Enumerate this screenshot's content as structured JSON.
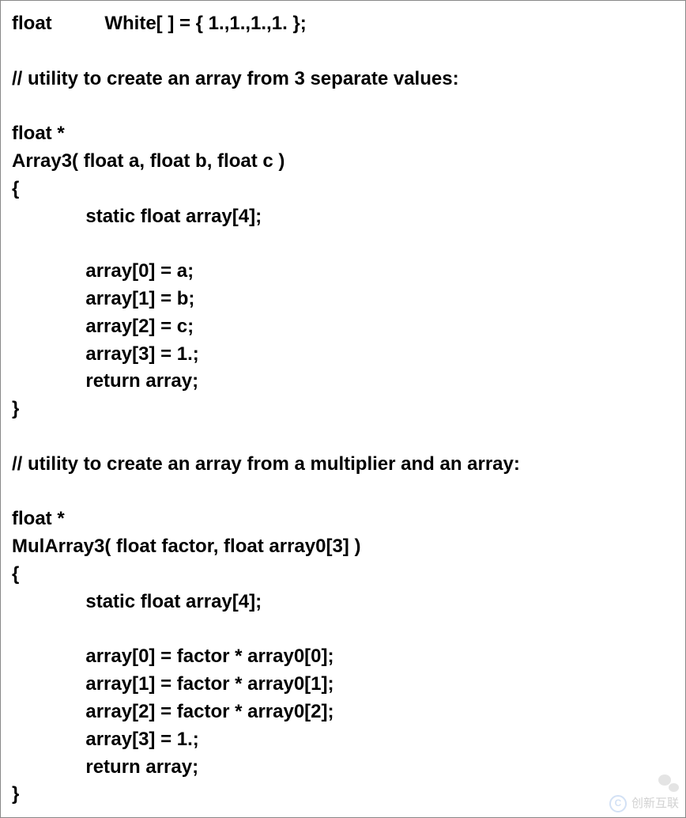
{
  "code": {
    "l1": "float          White[ ] = { 1.,1.,1.,1. };",
    "l2": "",
    "l3": "// utility to create an array from 3 separate values:",
    "l4": "",
    "l5": "float *",
    "l6": "Array3( float a, float b, float c )",
    "l7": "{",
    "l8": "              static float array[4];",
    "l9": "",
    "l10": "              array[0] = a;",
    "l11": "              array[1] = b;",
    "l12": "              array[2] = c;",
    "l13": "              array[3] = 1.;",
    "l14": "              return array;",
    "l15": "}",
    "l16": "",
    "l17": "// utility to create an array from a multiplier and an array:",
    "l18": "",
    "l19": "float *",
    "l20": "MulArray3( float factor, float array0[3] )",
    "l21": "{",
    "l22": "              static float array[4];",
    "l23": "",
    "l24": "              array[0] = factor * array0[0];",
    "l25": "              array[1] = factor * array0[1];",
    "l26": "              array[2] = factor * array0[2];",
    "l27": "              array[3] = 1.;",
    "l28": "              return array;",
    "l29": "}"
  },
  "watermark": {
    "brand": "创新互联"
  }
}
